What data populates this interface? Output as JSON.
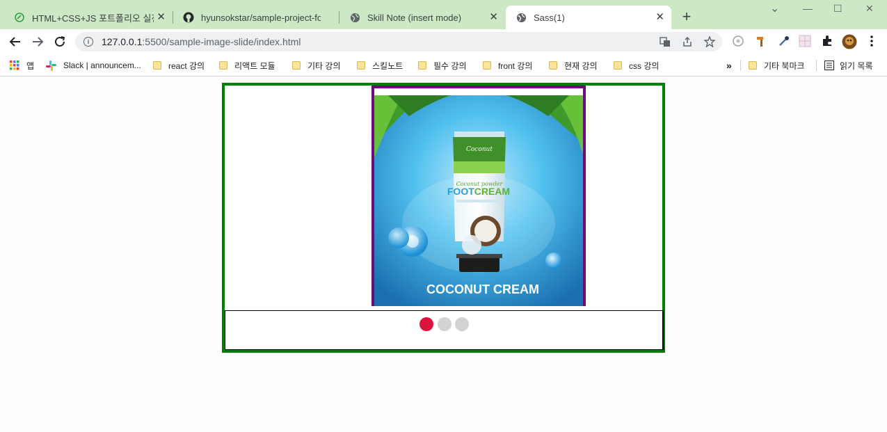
{
  "browser": {
    "tabs": [
      {
        "label": "HTML+CSS+JS 포트폴리오 실전",
        "icon": "leaf-icon",
        "active": false
      },
      {
        "label": "hyunsokstar/sample-project-for",
        "icon": "github-icon",
        "active": false
      },
      {
        "label": "Skill Note (insert mode)",
        "icon": "globe-icon",
        "active": false
      },
      {
        "label": "Sass(1)",
        "icon": "globe-icon",
        "active": true
      }
    ],
    "new_tab": "+",
    "window_controls": {
      "minimize": "—",
      "maximize": "☐",
      "close": "✕",
      "dropdown": "⌄"
    },
    "url_host": "127.0.0.1",
    "url_path": ":5500/sample-image-slide/index.html",
    "bookmarks": [
      {
        "label": "앱",
        "type": "apps"
      },
      {
        "label": "Slack | announcem...",
        "type": "slack"
      },
      {
        "label": "react 강의",
        "type": "folder"
      },
      {
        "label": "리액트 모듈",
        "type": "folder"
      },
      {
        "label": "기타 강의",
        "type": "folder"
      },
      {
        "label": "스킬노트",
        "type": "folder"
      },
      {
        "label": "필수 강의",
        "type": "folder"
      },
      {
        "label": "front 강의",
        "type": "folder"
      },
      {
        "label": "현재 강의",
        "type": "folder"
      },
      {
        "label": "css 강의",
        "type": "folder"
      }
    ],
    "bookmarks_overflow": "»",
    "other_bookmarks": "기타 북마크",
    "reading_list": "읽기 목록"
  },
  "slider": {
    "image_caption": "COCONUT CREAM",
    "product_name_1": "FOOT",
    "product_name_2": "CREAM",
    "active_dot": 0,
    "dot_count": 3,
    "colors": {
      "frame": "#008000",
      "image_border": "#6a0d7a",
      "dot_active": "#dc143c",
      "dot_inactive": "#d3d3d3"
    }
  }
}
